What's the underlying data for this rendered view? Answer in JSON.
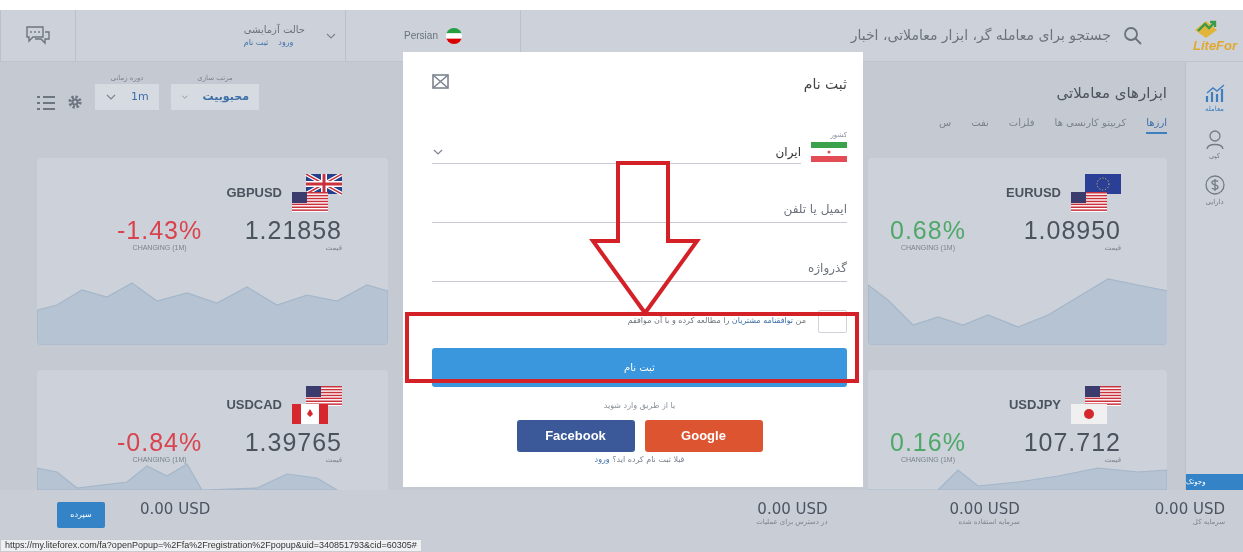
{
  "header": {
    "logo": "LiteFor",
    "search": {
      "placeholder": "جستجو برای معامله گر، ابزار معاملاتی، اخبار"
    },
    "language": "Persian",
    "account": {
      "mode": "حالت آزمایشی",
      "links": [
        "ورود",
        "ثبت نام"
      ]
    }
  },
  "sidebar": {
    "items": [
      {
        "label": "معامله",
        "selected": true
      },
      {
        "label": "کپی",
        "selected": false
      },
      {
        "label": "دارایی",
        "selected": false
      }
    ],
    "promo": "وجوتک"
  },
  "toolbar": {
    "title": "ابزارهای معاملاتی",
    "tabs": [
      {
        "label": "ارزها",
        "selected": true
      },
      {
        "label": "کریپتو کارنسی ها",
        "selected": false
      },
      {
        "label": "فلزات",
        "selected": false
      },
      {
        "label": "نفت",
        "selected": false
      },
      {
        "label": "س",
        "selected": false
      }
    ],
    "sort": {
      "label": "مرتب سازی",
      "value": "محبوبیت"
    },
    "period": {
      "label": "دوره زمانی",
      "value": "1m"
    }
  },
  "card_columns": [
    [
      {
        "pair": "EURUSD",
        "price": "1.08950",
        "price_label": "قیمت",
        "change": "0.68%",
        "change_label": "CHANGING (1M)",
        "color": "#4fa86a"
      },
      {
        "pair": "USDJPY",
        "price": "107.712",
        "price_label": "قیمت",
        "change": "0.16%",
        "change_label": "CHANGING (1M)",
        "color": "#4fa86a"
      }
    ],
    [
      {
        "pair": "GBPUSD",
        "price": "1.21858",
        "price_label": "قیمت",
        "change": "-1.43%",
        "change_label": "CHANGING (1M)",
        "color": "#d9434e"
      },
      {
        "pair": "USDCAD",
        "price": "1.39765",
        "price_label": "قیمت",
        "change": "-0.84%",
        "change_label": "CHANGING (1M)",
        "color": "#d9434e"
      }
    ]
  ],
  "bottom_bar": {
    "balances": [
      {
        "value": "0.00 USD",
        "label": "سرمایه کل"
      },
      {
        "value": "0.00 USD",
        "label": "سرمایه استفاده شده"
      },
      {
        "value": "0.00 USD",
        "label": "در دسترس برای عملیات"
      },
      {
        "value": "0.00 USD"
      }
    ],
    "deposit_button": "سپرده"
  },
  "status_url": "https://my.liteforex.com/fa?openPopup=%2Ffa%2Fregistration%2Fpopup&uid=340851793&cid=60305#",
  "modal": {
    "title": "ثبت نام",
    "country": {
      "label": "کشور",
      "value": "ایران"
    },
    "email": {
      "placeholder": "ایمیل یا تلفن"
    },
    "password": {
      "placeholder": "گذرواژه"
    },
    "agreement": {
      "checked": false,
      "before": "من ",
      "link": "توافقنامه مشتریان",
      "after": " را مطالعه کرده و با آن موافقم"
    },
    "submit": "ثبت نام",
    "social_hint": "یا از طریق وارد شوید",
    "social": [
      {
        "label": "Google",
        "color": "#dd5431"
      },
      {
        "label": "Facebook",
        "color": "#3b5998"
      }
    ],
    "login_prompt": "قبلا ثبت نام کرده اید؟",
    "login_link": "ورود"
  }
}
